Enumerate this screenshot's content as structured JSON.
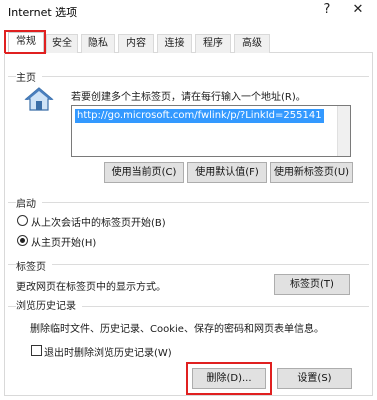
{
  "window": {
    "title": "Internet 选项",
    "help": "?",
    "close": "✕"
  },
  "tabs": [
    {
      "label": "常规",
      "active": true
    },
    {
      "label": "安全"
    },
    {
      "label": "隐私"
    },
    {
      "label": "内容"
    },
    {
      "label": "连接"
    },
    {
      "label": "程序"
    },
    {
      "label": "高级"
    }
  ],
  "homepage": {
    "group_label": "主页",
    "description": "若要创建多个主标签页，请在每行输入一个地址(R)。",
    "url": "http://go.microsoft.com/fwlink/p/?LinkId=255141",
    "btn_use_current": "使用当前页(C)",
    "btn_use_default": "使用默认值(F)",
    "btn_use_new_tab": "使用新标签页(U)",
    "icon": "home-icon"
  },
  "startup": {
    "group_label": "启动",
    "option1": "从上次会话中的标签页开始(B)",
    "option2": "从主页开始(H)",
    "selected": 2
  },
  "tabs_section": {
    "group_label": "标签页",
    "description": "更改网页在标签页中的显示方式。",
    "btn_tabs": "标签页(T)"
  },
  "history": {
    "group_label": "浏览历史记录",
    "description": "删除临时文件、历史记录、Cookie、保存的密码和网页表单信息。",
    "checkbox_label": "退出时删除浏览历史记录(W)",
    "checked": false,
    "btn_delete": "删除(D)...",
    "btn_settings": "设置(S)"
  },
  "colors": {
    "highlight": "#e02020",
    "selection": "#3399ff"
  }
}
